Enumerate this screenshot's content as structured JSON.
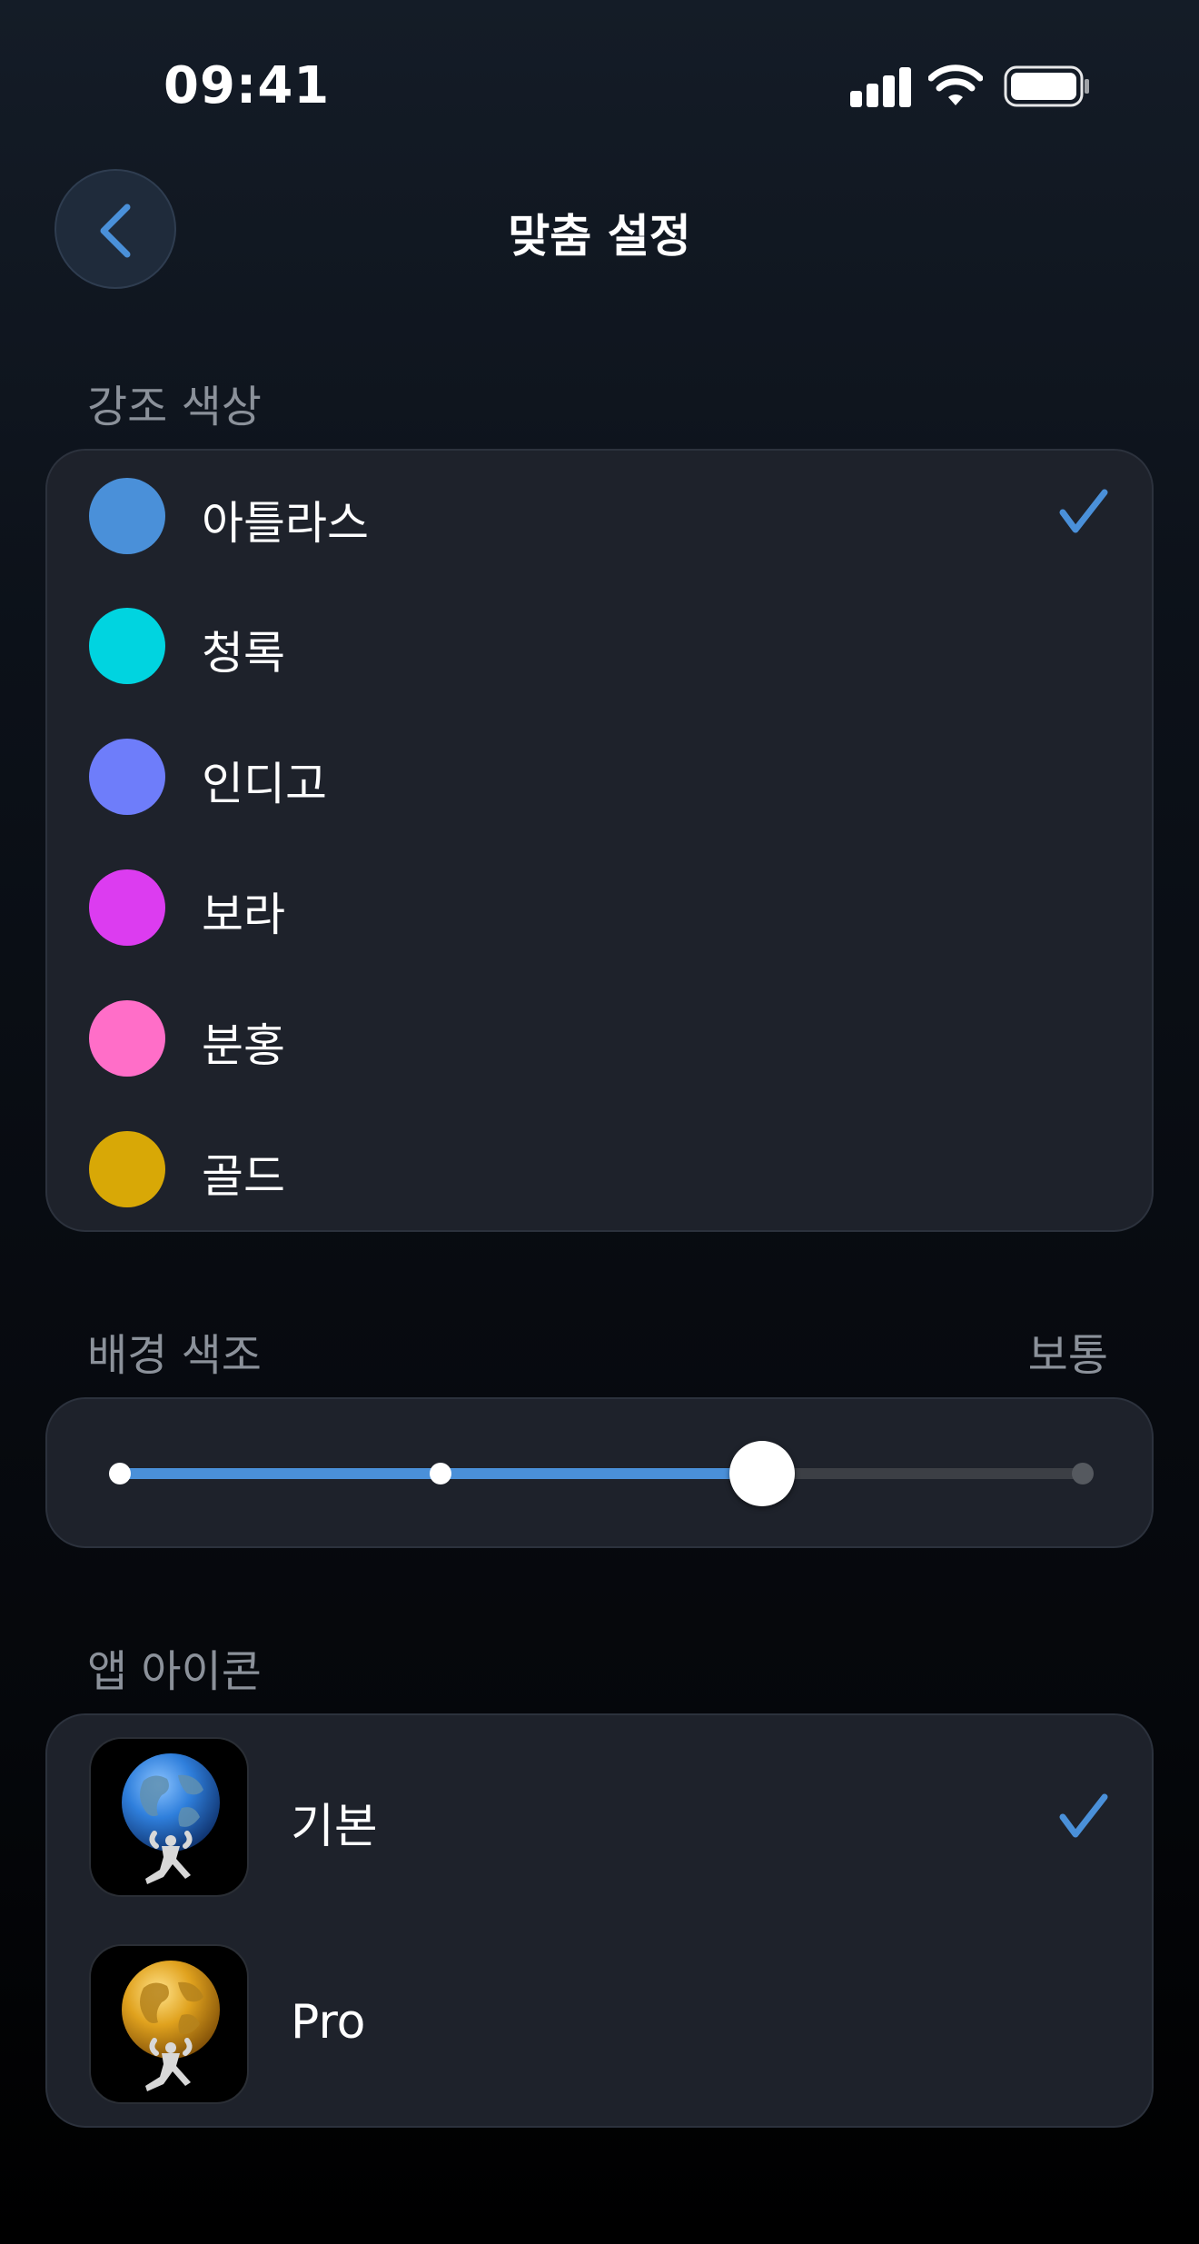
{
  "status_bar": {
    "time": "09:41"
  },
  "nav": {
    "title": "맞춤 설정"
  },
  "accent": {
    "label": "강조 색상",
    "selected": "아틀라스",
    "colors": [
      {
        "name": "아틀라스",
        "hex": "#4a90d9",
        "selected": true
      },
      {
        "name": "청록",
        "hex": "#00d4e0",
        "selected": false
      },
      {
        "name": "인디고",
        "hex": "#6e7dfa",
        "selected": false
      },
      {
        "name": "보라",
        "hex": "#dc3cf0",
        "selected": false
      },
      {
        "name": "분홍",
        "hex": "#ff6ec8",
        "selected": false
      },
      {
        "name": "골드",
        "hex": "#d8a806",
        "selected": false
      }
    ]
  },
  "background_tone": {
    "label": "배경 색조",
    "value": "보통",
    "level_index": 2,
    "level_count": 4,
    "fill_color": "#4a90d9"
  },
  "app_icon": {
    "label": "앱 아이콘",
    "options": [
      {
        "name": "기본",
        "icon": "atlas-blue-globe-icon",
        "selected": true
      },
      {
        "name": "Pro",
        "icon": "atlas-gold-globe-icon",
        "selected": false
      }
    ]
  }
}
